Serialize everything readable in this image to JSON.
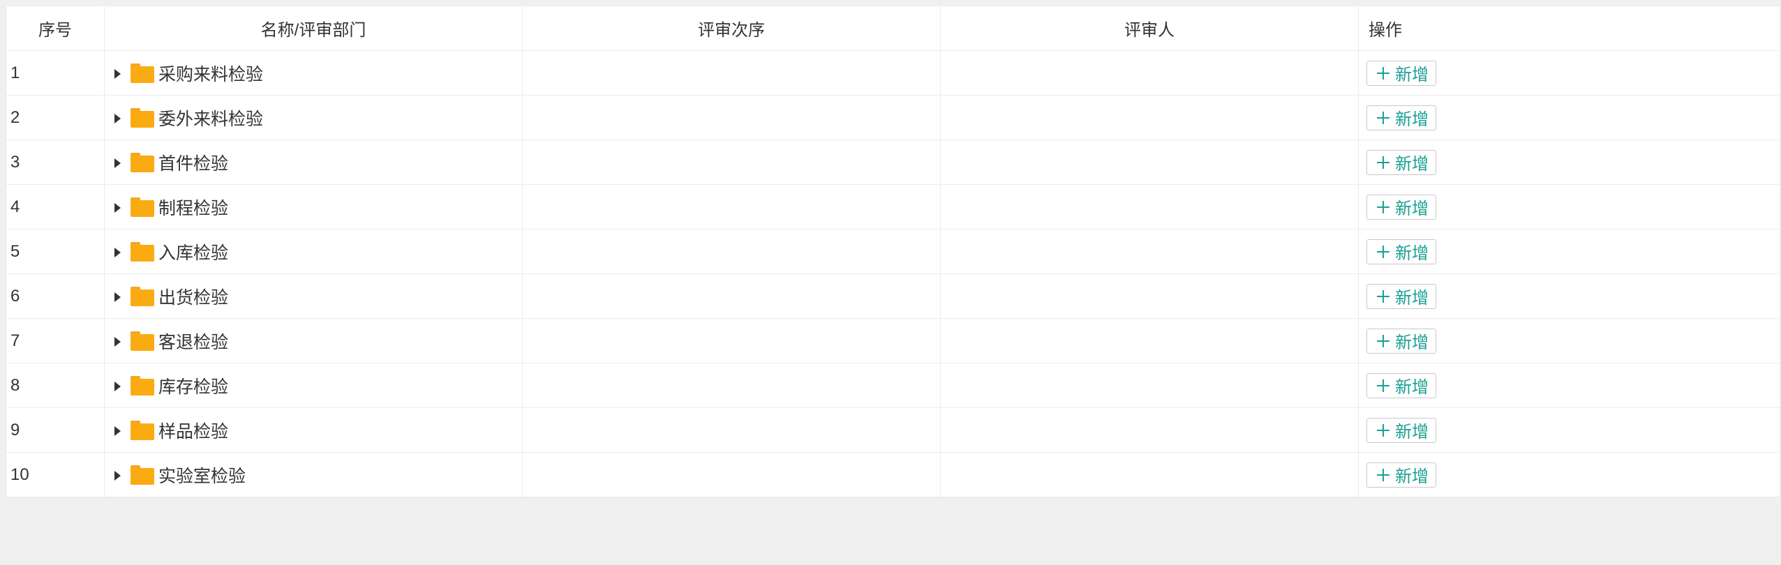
{
  "table": {
    "headers": {
      "index": "序号",
      "name": "名称/评审部门",
      "order": "评审次序",
      "reviewer": "评审人",
      "actions": "操作"
    },
    "add_label": "新增",
    "rows": [
      {
        "index": "1",
        "name": "采购来料检验",
        "order": "",
        "reviewer": ""
      },
      {
        "index": "2",
        "name": "委外来料检验",
        "order": "",
        "reviewer": ""
      },
      {
        "index": "3",
        "name": "首件检验",
        "order": "",
        "reviewer": ""
      },
      {
        "index": "4",
        "name": "制程检验",
        "order": "",
        "reviewer": ""
      },
      {
        "index": "5",
        "name": "入库检验",
        "order": "",
        "reviewer": ""
      },
      {
        "index": "6",
        "name": "出货检验",
        "order": "",
        "reviewer": ""
      },
      {
        "index": "7",
        "name": "客退检验",
        "order": "",
        "reviewer": ""
      },
      {
        "index": "8",
        "name": "库存检验",
        "order": "",
        "reviewer": ""
      },
      {
        "index": "9",
        "name": "样品检验",
        "order": "",
        "reviewer": ""
      },
      {
        "index": "10",
        "name": "实验室检验",
        "order": "",
        "reviewer": ""
      }
    ]
  },
  "colors": {
    "accent": "#1aa094",
    "folder": "#fbab12",
    "background": "#f0f0f0"
  },
  "icons": {
    "expand": "caret-right-icon",
    "folder": "folder-icon",
    "add": "plus-icon"
  }
}
